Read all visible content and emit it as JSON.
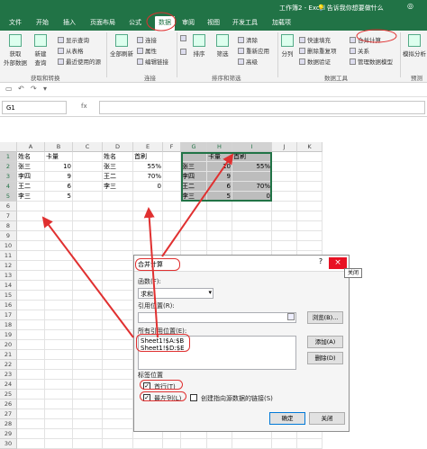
{
  "window": {
    "title": "工作簿2 - Excel"
  },
  "ribbon_tabs": [
    "文件",
    "开始",
    "插入",
    "页面布局",
    "公式",
    "数据",
    "审阅",
    "视图",
    "开发工具",
    "加载项"
  ],
  "active_tab": "数据",
  "tellme": "告诉我你想要做什么",
  "ribbon": {
    "get_external": "获取\n外部数据",
    "new_query": "新建\n查询",
    "show_queries": "显示查询",
    "from_table": "从表格",
    "recent_sources": "最近使用的源",
    "group_get": "获取和转换",
    "refresh_all": "全部刷新",
    "connections": "连接",
    "properties": "属性",
    "edit_links": "编辑链接",
    "group_conn": "连接",
    "sort": "排序",
    "filter": "筛选",
    "clear": "清除",
    "reapply": "重新应用",
    "advanced": "高级",
    "group_sort": "排序和筛选",
    "split": "分列",
    "flash_fill": "快速填充",
    "remove_dup": "删除重复项",
    "validation": "数据验证",
    "consolidate": "合并计算",
    "relationships": "关系",
    "manage_model": "管理数据模型",
    "group_tools": "数据工具",
    "whatif": "模拟分析",
    "group_forecast": "预测"
  },
  "name_box": "G1",
  "fx": "fx",
  "columns": [
    "A",
    "B",
    "C",
    "D",
    "E",
    "F",
    "G",
    "H",
    "I",
    "J",
    "K"
  ],
  "rows": [
    "1",
    "2",
    "3",
    "4",
    "5",
    "6",
    "7",
    "8",
    "9",
    "10",
    "11",
    "12",
    "13",
    "14",
    "15",
    "16",
    "17",
    "18",
    "19",
    "20",
    "21",
    "22",
    "23",
    "24",
    "25",
    "26",
    "27",
    "28",
    "29",
    "30"
  ],
  "table1": {
    "headers": [
      "姓名",
      "卡量"
    ],
    "rows": [
      [
        "张三",
        "10"
      ],
      [
        "李四",
        "9"
      ],
      [
        "王二",
        "6"
      ],
      [
        "李三",
        "5"
      ]
    ]
  },
  "table2": {
    "headers": [
      "姓名",
      "首刷"
    ],
    "rows": [
      [
        "张三",
        "55%"
      ],
      [
        "王二",
        "70%"
      ],
      [
        "李三",
        "0"
      ]
    ]
  },
  "result": {
    "headers": [
      "",
      "卡量",
      "首刷"
    ],
    "rows": [
      [
        "张三",
        "10",
        "55%"
      ],
      [
        "李四",
        "9",
        ""
      ],
      [
        "王二",
        "6",
        "70%"
      ],
      [
        "李三",
        "5",
        "0"
      ]
    ]
  },
  "dialog": {
    "title": "合并计算",
    "help": "?",
    "close": "×",
    "tooltip": "关闭",
    "func_label": "函数(F):",
    "func_value": "求和",
    "ref_label": "引用位置(R):",
    "browse": "浏览(B)...",
    "all_refs_label": "所有引用位置(E):",
    "refs": [
      "Sheet1!$A:$B",
      "Sheet1!$D:$E"
    ],
    "add": "添加(A)",
    "delete": "删除(D)",
    "tag_label": "标签位置",
    "first_row": "首行(T)",
    "left_col": "最左列(L)",
    "create_links": "创建指向源数据的链接(S)",
    "ok": "确定",
    "cancel": "关闭",
    "first_row_checked": true,
    "left_col_checked": true
  }
}
